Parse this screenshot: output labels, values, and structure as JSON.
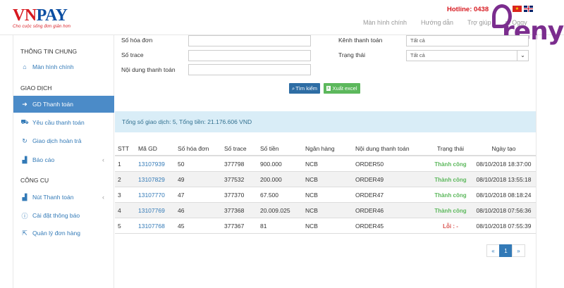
{
  "header": {
    "logo_vn": "VN",
    "logo_pay": "PAY",
    "logo_tagline": "Cho cuộc sống đơn giản hơn",
    "hotline": "Hotline: 0438",
    "nav": [
      "Màn hình chính",
      "Hướng dẫn",
      "Trợ giúp",
      "st Oggy"
    ],
    "overlay_brand": "reny"
  },
  "sidebar": {
    "sections": {
      "general": "THÔNG TIN CHUNG",
      "transactions": "GIAO DỊCH",
      "tools": "CÔNG CỤ"
    },
    "items": [
      {
        "label": "Màn hình chính",
        "icon": "home-icon"
      },
      {
        "label": "GD Thanh toán",
        "icon": "login-icon",
        "active": true
      },
      {
        "label": "Yêu cầu thanh toán",
        "icon": "cart-icon"
      },
      {
        "label": "Giao dịch hoàn trả",
        "icon": "refresh-icon"
      },
      {
        "label": "Báo cáo",
        "icon": "chart-icon"
      },
      {
        "label": "Nút Thanh toán",
        "icon": "chart-icon"
      },
      {
        "label": "Cài đặt thông báo",
        "icon": "info-icon"
      },
      {
        "label": "Quản lý đơn hàng",
        "icon": "pointer-icon"
      }
    ]
  },
  "filters": {
    "invoice_label": "Số hóa đơn",
    "trace_label": "Số trace",
    "content_label": "Nội dung thanh toán",
    "channel_label": "Kênh thanh toán",
    "channel_value": "Tất cả",
    "status_label": "Trạng thái",
    "status_value": "Tất cả",
    "search_button": "Tìm kiếm",
    "excel_button": "Xuất excel"
  },
  "summary": "Tổng số giao dịch: 5, Tổng tiền: 21.176.606 VND",
  "table": {
    "headers": [
      "STT",
      "Mã GD",
      "Số hóa đơn",
      "Số trace",
      "Số tiền",
      "Ngân hàng",
      "Nội dung thanh toán",
      "Trạng thái",
      "Ngày tạo"
    ],
    "rows": [
      [
        "1",
        "13107939",
        "50",
        "377798",
        "900.000",
        "NCB",
        "ORDER50",
        "Thành công",
        "08/10/2018 18:37:00"
      ],
      [
        "2",
        "13107829",
        "49",
        "377532",
        "200.000",
        "NCB",
        "ORDER49",
        "Thành công",
        "08/10/2018 13:55:18"
      ],
      [
        "3",
        "13107770",
        "47",
        "377370",
        "67.500",
        "NCB",
        "ORDER47",
        "Thành công",
        "08/10/2018 08:18:24"
      ],
      [
        "4",
        "13107769",
        "46",
        "377368",
        "20.009.025",
        "NCB",
        "ORDER46",
        "Thành công",
        "08/10/2018 07:56:36"
      ],
      [
        "5",
        "13107768",
        "45",
        "377367",
        "81",
        "NCB",
        "ORDER45",
        "Lỗi : -",
        "08/10/2018 07:55:39"
      ]
    ]
  },
  "pagination": {
    "prev": "«",
    "current": "1",
    "next": "»"
  },
  "colors": {
    "accent": "#4b8bc8",
    "success": "#5cb85c",
    "error": "#d9534f",
    "brand_red": "#d71920",
    "brand_blue": "#0b4ea2"
  }
}
